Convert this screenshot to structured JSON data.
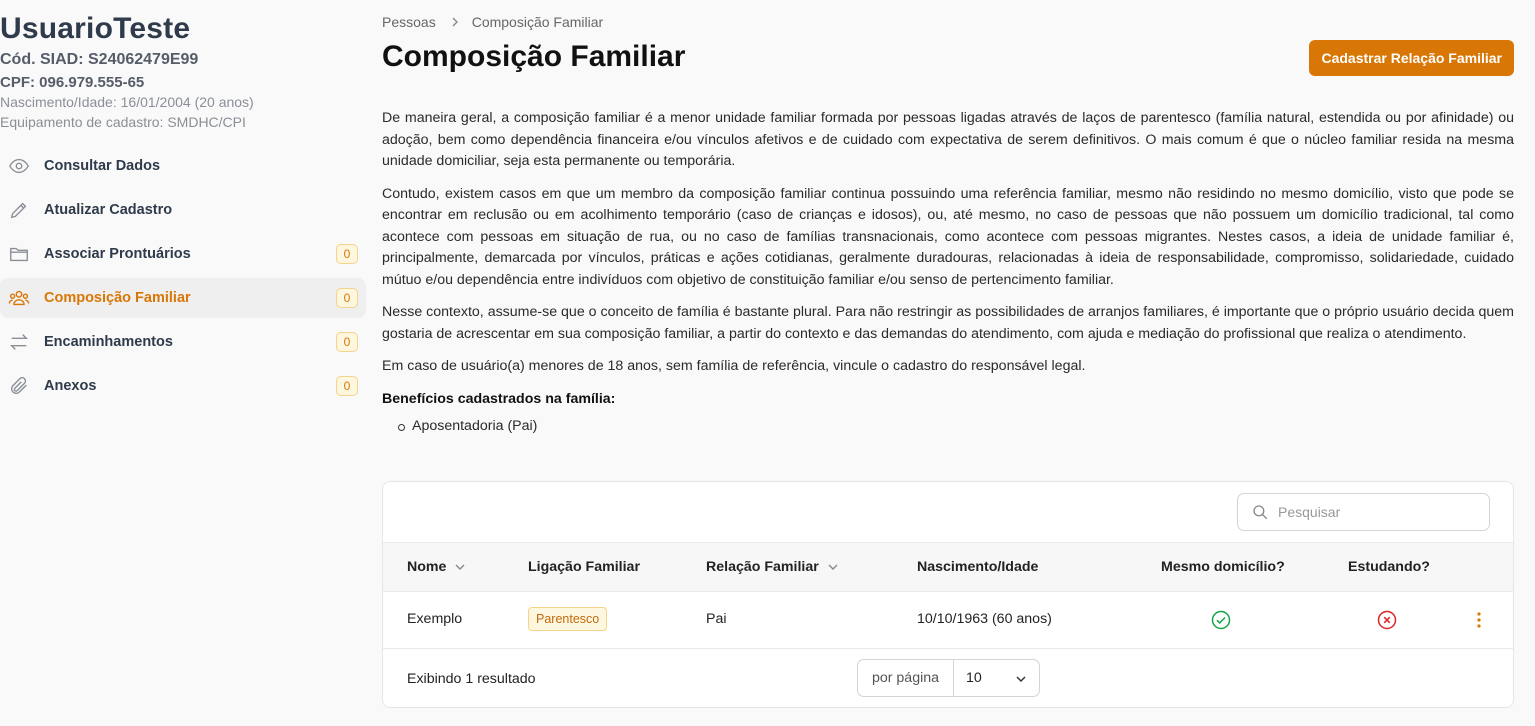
{
  "user": {
    "name": "UsuarioTeste",
    "siad": "Cód. SIAD: S24062479E99",
    "cpf": "CPF: 096.979.555-65",
    "birth": "Nascimento/Idade: 16/01/2004 (20 anos)",
    "equipment": "Equipamento de cadastro: SMDHC/CPI"
  },
  "sidebar": {
    "items": [
      {
        "label": "Consultar Dados",
        "icon": "eye-icon",
        "badge": null
      },
      {
        "label": "Atualizar Cadastro",
        "icon": "pencil-icon",
        "badge": null
      },
      {
        "label": "Associar Prontuários",
        "icon": "folder-icon",
        "badge": "0"
      },
      {
        "label": "Composição Familiar",
        "icon": "users-icon",
        "badge": "0",
        "active": true
      },
      {
        "label": "Encaminhamentos",
        "icon": "arrows-exchange-icon",
        "badge": "0"
      },
      {
        "label": "Anexos",
        "icon": "paperclip-icon",
        "badge": "0"
      }
    ]
  },
  "breadcrumb": {
    "parent": "Pessoas",
    "current": "Composição Familiar"
  },
  "page": {
    "title": "Composição Familiar",
    "primary_button": "Cadastrar Relação Familiar",
    "paragraphs": [
      "De maneira geral, a composição familiar é a menor unidade familiar formada por pessoas ligadas através de laços de parentesco (família natural, estendida ou por afinidade) ou adoção, bem como dependência financeira e/ou vínculos afetivos e de cuidado com expectativa de serem definitivos. O mais comum é que o núcleo familiar resida na mesma unidade domiciliar, seja esta permanente ou temporária.",
      "Contudo, existem casos em que um membro da composição familiar continua possuindo uma referência familiar, mesmo não residindo no mesmo domicílio, visto que pode se encontrar em reclusão ou em acolhimento temporário (caso de crianças e idosos), ou, até mesmo, no caso de pessoas que não possuem um domicílio tradicional, tal como acontece com pessoas em situação de rua, ou no caso de famílias transnacionais, como acontece com pessoas migrantes. Nestes casos, a ideia de unidade familiar é, principalmente, demarcada por vínculos, práticas e ações cotidianas, geralmente duradouras, relacionadas à ideia de responsabilidade, compromisso, solidariedade, cuidado mútuo e/ou dependência entre indivíduos com objetivo de constituição familiar e/ou senso de pertencimento familiar.",
      "Nesse contexto, assume-se que o conceito de família é bastante plural. Para não restringir as possibilidades de arranjos familiares, é importante que o próprio usuário decida quem gostaria de acrescentar em sua composição familiar, a partir do contexto e das demandas do atendimento, com ajuda e mediação do profissional que realiza o atendimento.",
      "Em caso de usuário(a) menores de 18 anos, sem família de referência, vincule o cadastro do responsável legal."
    ],
    "benefits_title": "Benefícios cadastrados na família:",
    "benefits": [
      "Aposentadoria (Pai)"
    ]
  },
  "table": {
    "search_placeholder": "Pesquisar",
    "columns": [
      "Nome",
      "Ligação Familiar",
      "Relação Familiar",
      "Nascimento/Idade",
      "Mesmo domicílio?",
      "Estudando?"
    ],
    "rows": [
      {
        "nome": "Exemplo",
        "ligacao": "Parentesco",
        "relacao": "Pai",
        "nascimento": "10/10/1963 (60 anos)",
        "mesmo_domicilio": true,
        "estudando": false
      }
    ],
    "footer_text": "Exibindo 1 resultado",
    "per_page_label": "por página",
    "per_page_value": "10"
  },
  "colors": {
    "accent": "#d97706",
    "success": "#16a34a",
    "danger": "#dc2626"
  }
}
